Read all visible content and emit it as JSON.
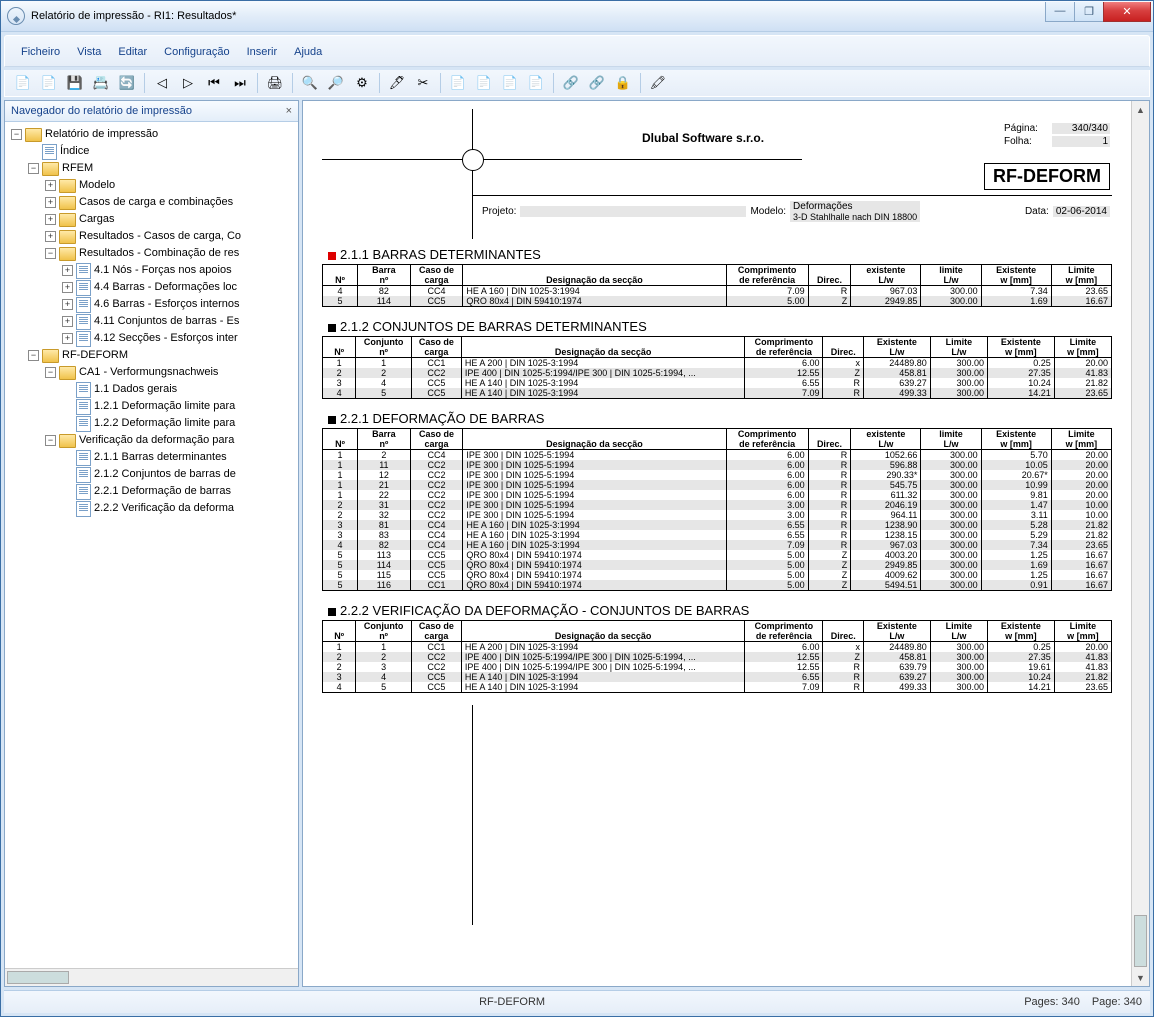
{
  "window": {
    "title": "Relatório de impressão - RI1: Resultados*"
  },
  "menu": [
    "Ficheiro",
    "Vista",
    "Editar",
    "Configuração",
    "Inserir",
    "Ajuda"
  ],
  "toolbar": [
    "📄",
    "📄",
    "💾",
    "📇",
    "🔄",
    "",
    "◁",
    "▷",
    "⏮",
    "⏭",
    "",
    "🖨",
    "",
    "🔍",
    "🔎",
    "⚙",
    "",
    "🖊",
    "✂",
    "",
    "📄",
    "📄",
    "📄",
    "📄",
    "",
    "🔗",
    "🔗",
    "🔒",
    "",
    "🖍"
  ],
  "sidebar": {
    "title": "Navegador do relatório de impressão",
    "tree": [
      {
        "l": "Relatório de impressão",
        "t": "-",
        "i": "folder",
        "c": [
          {
            "l": "Índice",
            "t": "·",
            "i": "doc"
          },
          {
            "l": "RFEM",
            "t": "-",
            "i": "folder",
            "c": [
              {
                "l": "Modelo",
                "t": "+",
                "i": "folder"
              },
              {
                "l": "Casos de carga e combinações",
                "t": "+",
                "i": "folder"
              },
              {
                "l": "Cargas",
                "t": "+",
                "i": "folder"
              },
              {
                "l": "Resultados - Casos de carga, Co",
                "t": "+",
                "i": "folder"
              },
              {
                "l": "Resultados - Combinação de res",
                "t": "-",
                "i": "folder",
                "c": [
                  {
                    "l": "4.1 Nós - Forças nos apoios",
                    "t": "+",
                    "i": "doc"
                  },
                  {
                    "l": "4.4 Barras - Deformações loc",
                    "t": "+",
                    "i": "doc"
                  },
                  {
                    "l": "4.6 Barras - Esforços internos",
                    "t": "+",
                    "i": "doc"
                  },
                  {
                    "l": "4.11 Conjuntos de barras - Es",
                    "t": "+",
                    "i": "doc"
                  },
                  {
                    "l": "4.12 Secções - Esforços inter",
                    "t": "+",
                    "i": "doc"
                  }
                ]
              }
            ]
          },
          {
            "l": "RF-DEFORM",
            "t": "-",
            "i": "folder",
            "c": [
              {
                "l": "CA1 - Verformungsnachweis",
                "t": "-",
                "i": "folder",
                "c": [
                  {
                    "l": "1.1 Dados gerais",
                    "t": "·",
                    "i": "doc"
                  },
                  {
                    "l": "1.2.1 Deformação limite para",
                    "t": "·",
                    "i": "doc"
                  },
                  {
                    "l": "1.2.2 Deformação limite para",
                    "t": "·",
                    "i": "doc"
                  }
                ]
              },
              {
                "l": "Verificação da deformação para",
                "t": "-",
                "i": "folder",
                "c": [
                  {
                    "l": "2.1.1 Barras determinantes",
                    "t": "·",
                    "i": "doc"
                  },
                  {
                    "l": "2.1.2 Conjuntos de barras de",
                    "t": "·",
                    "i": "doc"
                  },
                  {
                    "l": "2.2.1 Deformação de barras",
                    "t": "·",
                    "i": "doc"
                  },
                  {
                    "l": "2.2.2 Verificação da deforma",
                    "t": "·",
                    "i": "doc"
                  }
                ]
              }
            ]
          }
        ]
      }
    ]
  },
  "report": {
    "company": "Dlubal Software s.r.o.",
    "page_lbl": "Página:",
    "page_val": "340/340",
    "sheet_lbl": "Folha:",
    "sheet_val": "1",
    "module": "RF-DEFORM",
    "proj_lbl": "Projeto:",
    "model_lbl": "Modelo:",
    "model_val": "Deformações",
    "model_sub": "3-D Stahlhalle nach DIN 18800",
    "date_lbl": "Data:",
    "date_val": "02-06-2014"
  },
  "t211": {
    "title": "2.1.1 BARRAS DETERMINANTES",
    "h1": [
      "",
      "Barra",
      "Caso de",
      "",
      "Comprimento",
      "",
      "existente",
      "limite",
      "Existente",
      "Limite"
    ],
    "h2": [
      "Nº",
      "nº",
      "carga",
      "Designação da secção",
      "de referência",
      "Direc.",
      "L/w",
      "L/w",
      "w [mm]",
      "w [mm]"
    ],
    "rows": [
      [
        "4",
        "82",
        "CC4",
        "HE A 160 | DIN 1025-3:1994",
        "7.09",
        "R",
        "967.03",
        "300.00",
        "7.34",
        "23.65"
      ],
      [
        "5",
        "114",
        "CC5",
        "QRO 80x4 | DIN 59410:1974",
        "5.00",
        "Z",
        "2949.85",
        "300.00",
        "1.69",
        "16.67"
      ]
    ]
  },
  "t212": {
    "title": "2.1.2 CONJUNTOS DE BARRAS DETERMINANTES",
    "h1": [
      "",
      "Conjunto",
      "Caso de",
      "",
      "Comprimento",
      "",
      "Existente",
      "Limite",
      "Existente",
      "Limite"
    ],
    "h2": [
      "Nº",
      "nº",
      "carga",
      "Designação da secção",
      "de referência",
      "Direc.",
      "L/w",
      "L/w",
      "w [mm]",
      "w [mm]"
    ],
    "rows": [
      [
        "1",
        "1",
        "CC1",
        "HE A 200 | DIN 1025-3:1994",
        "6.00",
        "x",
        "24489.80",
        "300.00",
        "0.25",
        "20.00"
      ],
      [
        "2",
        "2",
        "CC2",
        "IPE 400 | DIN 1025-5:1994/IPE 300 | DIN 1025-5:1994, ...",
        "12.55",
        "Z",
        "458.81",
        "300.00",
        "27.35",
        "41.83"
      ],
      [
        "3",
        "4",
        "CC5",
        "HE A 140 | DIN 1025-3:1994",
        "6.55",
        "R",
        "639.27",
        "300.00",
        "10.24",
        "21.82"
      ],
      [
        "4",
        "5",
        "CC5",
        "HE A 140 | DIN 1025-3:1994",
        "7.09",
        "R",
        "499.33",
        "300.00",
        "14.21",
        "23.65"
      ]
    ]
  },
  "t221": {
    "title": "2.2.1 DEFORMAÇÃO DE BARRAS",
    "h1": [
      "",
      "Barra",
      "Caso de",
      "",
      "Comprimento",
      "",
      "existente",
      "limite",
      "Existente",
      "Limite"
    ],
    "h2": [
      "Nº",
      "nº",
      "carga",
      "Designação da secção",
      "de referência",
      "Direc.",
      "L/w",
      "L/w",
      "w [mm]",
      "w [mm]"
    ],
    "rows": [
      [
        "1",
        "2",
        "CC4",
        "IPE 300 | DIN 1025-5:1994",
        "6.00",
        "R",
        "1052.66",
        "300.00",
        "5.70",
        "20.00"
      ],
      [
        "1",
        "11",
        "CC2",
        "IPE 300 | DIN 1025-5:1994",
        "6.00",
        "R",
        "596.88",
        "300.00",
        "10.05",
        "20.00"
      ],
      [
        "1",
        "12",
        "CC2",
        "IPE 300 | DIN 1025-5:1994",
        "6.00",
        "R",
        "290.33*",
        "300.00",
        "20.67*",
        "20.00"
      ],
      [
        "1",
        "21",
        "CC2",
        "IPE 300 | DIN 1025-5:1994",
        "6.00",
        "R",
        "545.75",
        "300.00",
        "10.99",
        "20.00"
      ],
      [
        "1",
        "22",
        "CC2",
        "IPE 300 | DIN 1025-5:1994",
        "6.00",
        "R",
        "611.32",
        "300.00",
        "9.81",
        "20.00"
      ],
      [
        "2",
        "31",
        "CC2",
        "IPE 300 | DIN 1025-5:1994",
        "3.00",
        "R",
        "2046.19",
        "300.00",
        "1.47",
        "10.00"
      ],
      [
        "2",
        "32",
        "CC2",
        "IPE 300 | DIN 1025-5:1994",
        "3.00",
        "R",
        "964.11",
        "300.00",
        "3.11",
        "10.00"
      ],
      [
        "3",
        "81",
        "CC4",
        "HE A 160 | DIN 1025-3:1994",
        "6.55",
        "R",
        "1238.90",
        "300.00",
        "5.28",
        "21.82"
      ],
      [
        "3",
        "83",
        "CC4",
        "HE A 160 | DIN 1025-3:1994",
        "6.55",
        "R",
        "1238.15",
        "300.00",
        "5.29",
        "21.82"
      ],
      [
        "4",
        "82",
        "CC4",
        "HE A 160 | DIN 1025-3:1994",
        "7.09",
        "R",
        "967.03",
        "300.00",
        "7.34",
        "23.65"
      ],
      [
        "5",
        "113",
        "CC5",
        "QRO 80x4 | DIN 59410:1974",
        "5.00",
        "Z",
        "4003.20",
        "300.00",
        "1.25",
        "16.67"
      ],
      [
        "5",
        "114",
        "CC5",
        "QRO 80x4 | DIN 59410:1974",
        "5.00",
        "Z",
        "2949.85",
        "300.00",
        "1.69",
        "16.67"
      ],
      [
        "5",
        "115",
        "CC5",
        "QRO 80x4 | DIN 59410:1974",
        "5.00",
        "Z",
        "4009.62",
        "300.00",
        "1.25",
        "16.67"
      ],
      [
        "5",
        "116",
        "CC1",
        "QRO 80x4 | DIN 59410:1974",
        "5.00",
        "Z",
        "5494.51",
        "300.00",
        "0.91",
        "16.67"
      ]
    ]
  },
  "t222": {
    "title": "2.2.2 VERIFICAÇÃO DA DEFORMAÇÃO - CONJUNTOS DE BARRAS",
    "h1": [
      "",
      "Conjunto",
      "Caso de",
      "",
      "Comprimento",
      "",
      "Existente",
      "Limite",
      "Existente",
      "Limite"
    ],
    "h2": [
      "Nº",
      "nº",
      "carga",
      "Designação da secção",
      "de referência",
      "Direc.",
      "L/w",
      "L/w",
      "w [mm]",
      "w [mm]"
    ],
    "rows": [
      [
        "1",
        "1",
        "CC1",
        "HE A 200 | DIN 1025-3:1994",
        "6.00",
        "x",
        "24489.80",
        "300.00",
        "0.25",
        "20.00"
      ],
      [
        "2",
        "2",
        "CC2",
        "IPE 400 | DIN 1025-5:1994/IPE 300 | DIN 1025-5:1994, ...",
        "12.55",
        "Z",
        "458.81",
        "300.00",
        "27.35",
        "41.83"
      ],
      [
        "2",
        "3",
        "CC2",
        "IPE 400 | DIN 1025-5:1994/IPE 300 | DIN 1025-5:1994, ...",
        "12.55",
        "R",
        "639.79",
        "300.00",
        "19.61",
        "41.83"
      ],
      [
        "3",
        "4",
        "CC5",
        "HE A 140 | DIN 1025-3:1994",
        "6.55",
        "R",
        "639.27",
        "300.00",
        "10.24",
        "21.82"
      ],
      [
        "4",
        "5",
        "CC5",
        "HE A 140 | DIN 1025-3:1994",
        "7.09",
        "R",
        "499.33",
        "300.00",
        "14.21",
        "23.65"
      ]
    ]
  },
  "status": {
    "mid": "RF-DEFORM",
    "pages": "Pages: 340",
    "page": "Page: 340"
  }
}
